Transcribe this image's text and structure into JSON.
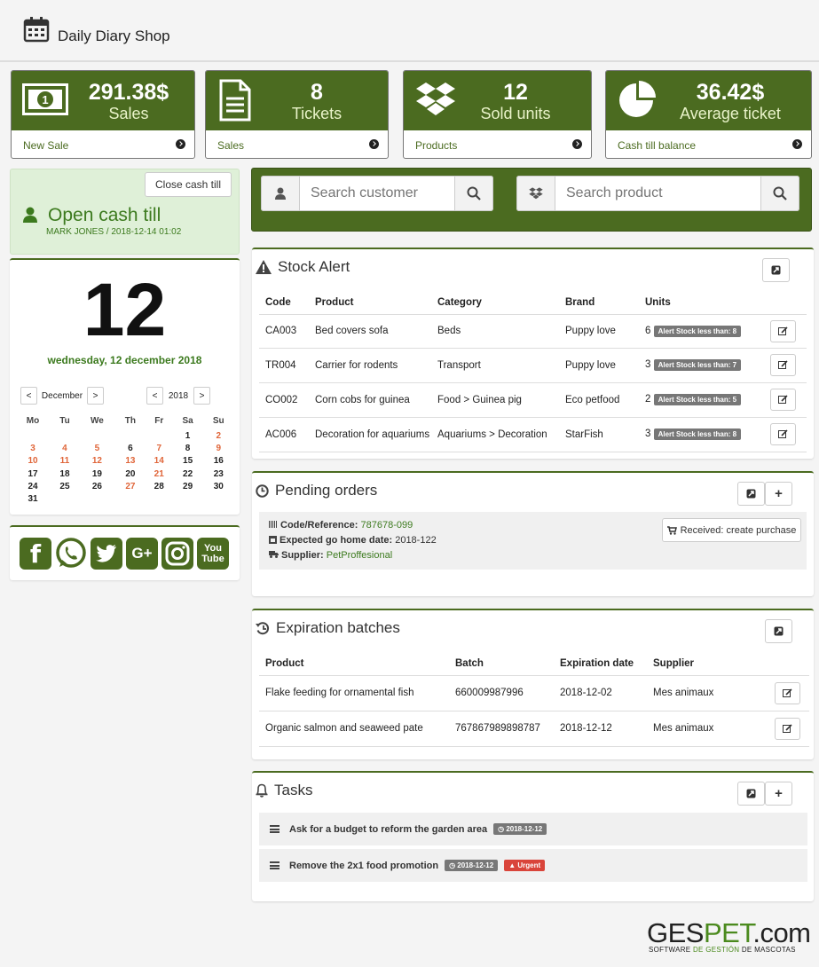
{
  "app": {
    "title": "Daily Diary Shop"
  },
  "stats": [
    {
      "value": "291.38",
      "currency": "$",
      "label": "Sales",
      "link": "New Sale"
    },
    {
      "value": "8",
      "currency": "",
      "label": "Tickets",
      "link": "Sales"
    },
    {
      "value": "12",
      "currency": "",
      "label": "Sold units",
      "link": "Products"
    },
    {
      "value": "36.42",
      "currency": "$",
      "label": "Average ticket",
      "link": "Cash till balance"
    }
  ],
  "cash": {
    "close_label": "Close cash till",
    "title": "Open cash till",
    "subtitle": "MARK JONES / 2018-12-14 01:02"
  },
  "calendar": {
    "day": "12",
    "date_text": "wednesday, 12 december 2018",
    "month": "December",
    "year": "2018",
    "prev": "<",
    "next": ">",
    "weekdays": [
      "Mo",
      "Tu",
      "We",
      "Th",
      "Fr",
      "Sa",
      "Su"
    ],
    "weeks": [
      [
        "",
        "",
        "",
        "",
        "",
        "1",
        "2"
      ],
      [
        "3",
        "4",
        "5",
        "6",
        "7",
        "8",
        "9"
      ],
      [
        "10",
        "11",
        "12",
        "13",
        "14",
        "15",
        "16"
      ],
      [
        "17",
        "18",
        "19",
        "20",
        "21",
        "22",
        "23"
      ],
      [
        "24",
        "25",
        "26",
        "27",
        "28",
        "29",
        "30"
      ],
      [
        "31",
        "",
        "",
        "",
        "",
        "",
        ""
      ]
    ],
    "highlight_color": "#e0663a"
  },
  "social": [
    "f",
    "whatsapp",
    "twitter",
    "G+",
    "instagram",
    "You Tube"
  ],
  "search": {
    "customer_placeholder": "Search customer",
    "product_placeholder": "Search product"
  },
  "stock": {
    "title": "Stock Alert",
    "headers": [
      "Code",
      "Product",
      "Category",
      "Brand",
      "Units"
    ],
    "rows": [
      {
        "code": "CA003",
        "product": "Bed covers sofa",
        "category": "Beds",
        "brand": "Puppy love",
        "units": "6",
        "alert": "Alert Stock less than: 8"
      },
      {
        "code": "TR004",
        "product": "Carrier for rodents",
        "category": "Transport",
        "brand": "Puppy love",
        "units": "3",
        "alert": "Alert Stock less than: 7"
      },
      {
        "code": "CO002",
        "product": "Corn cobs for guinea",
        "category": "Food > Guinea pig",
        "brand": "Eco petfood",
        "units": "2",
        "alert": "Alert Stock less than: 5"
      },
      {
        "code": "AC006",
        "product": "Decoration for aquariums",
        "category": "Aquariums > Decoration",
        "brand": "StarFish",
        "units": "3",
        "alert": "Alert Stock less than: 8"
      }
    ]
  },
  "orders": {
    "title": "Pending orders",
    "code_label": "Code/Reference:",
    "code_value": "787678-099",
    "date_label": "Expected go home date:",
    "date_value": "2018-122",
    "supplier_label": "Supplier:",
    "supplier_value": "PetProffesional",
    "action": "Received: create purchase"
  },
  "batches": {
    "title": "Expiration batches",
    "headers": [
      "Product",
      "Batch",
      "Expiration date",
      "Supplier"
    ],
    "rows": [
      {
        "product": "Flake feeding for ornamental fish",
        "batch": "660009987996",
        "date": "2018-12-02",
        "supplier": "Mes animaux"
      },
      {
        "product": "Organic salmon and seaweed pate",
        "batch": "767867989898787",
        "date": "2018-12-12",
        "supplier": "Mes animaux"
      }
    ]
  },
  "tasks": {
    "title": "Tasks",
    "items": [
      {
        "text": "Ask for a budget to reform the garden area",
        "date": "2018-12-12",
        "urgent": ""
      },
      {
        "text": "Remove the 2x1 food promotion",
        "date": "2018-12-12",
        "urgent": "Urgent"
      }
    ]
  },
  "brand": {
    "logo_a": "GES",
    "logo_b": "PET",
    "logo_c": ".com",
    "sub_a": "SOFTWARE ",
    "sub_b": "DE GESTIÓN",
    "sub_c": " DE MASCOTAS"
  },
  "colors": {
    "accent": "#4b6b20",
    "accent_light": "#dff0d8",
    "link": "#3c7a1e",
    "orange": "#e0663a",
    "urgent": "#d9443a"
  }
}
